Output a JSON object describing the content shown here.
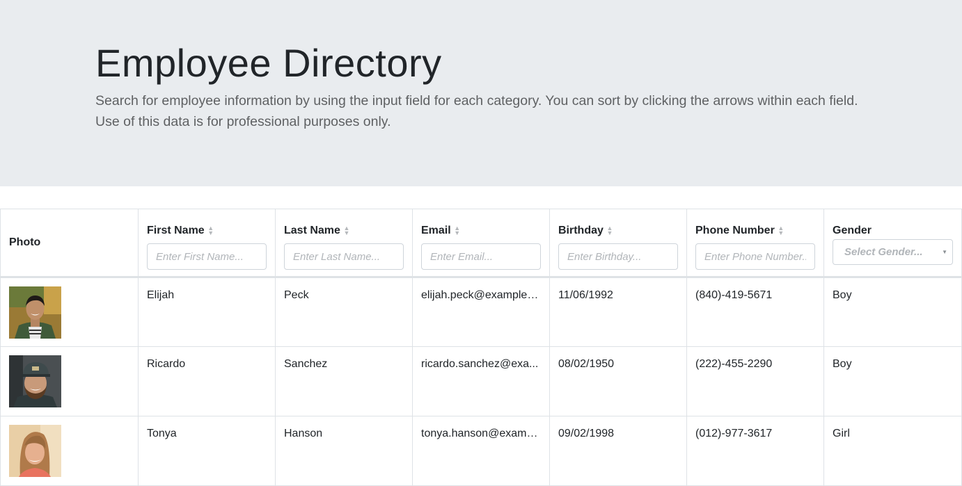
{
  "header": {
    "title": "Employee Directory",
    "description": "Search for employee information by using the input field for each category. You can sort by clicking the arrows within each field. Use of this data is for professional purposes only."
  },
  "table": {
    "columns": {
      "photo": "Photo",
      "first_name": "First Name",
      "last_name": "Last Name",
      "email": "Email",
      "birthday": "Birthday",
      "phone": "Phone Number",
      "gender": "Gender"
    },
    "filters": {
      "first_name_placeholder": "Enter First Name...",
      "last_name_placeholder": "Enter Last Name...",
      "email_placeholder": "Enter Email...",
      "birthday_placeholder": "Enter Birthday...",
      "phone_placeholder": "Enter Phone Number...",
      "gender_placeholder": "Select Gender..."
    },
    "rows": [
      {
        "first_name": "Elijah",
        "last_name": "Peck",
        "email": "elijah.peck@example.c...",
        "birthday": "11/06/1992",
        "phone": "(840)-419-5671",
        "gender": "Boy"
      },
      {
        "first_name": "Ricardo",
        "last_name": "Sanchez",
        "email": "ricardo.sanchez@exa...",
        "birthday": "08/02/1950",
        "phone": "(222)-455-2290",
        "gender": "Boy"
      },
      {
        "first_name": "Tonya",
        "last_name": "Hanson",
        "email": "tonya.hanson@examp...",
        "birthday": "09/02/1998",
        "phone": "(012)-977-3617",
        "gender": "Girl"
      }
    ]
  },
  "icons": {
    "sort": "sort-icon",
    "dropdown": "caret-down-icon",
    "photo": "employee-photo"
  },
  "colors": {
    "jumbotron_bg": "#e9ecef",
    "border": "#dee2e6",
    "placeholder": "#b1b5b9"
  }
}
